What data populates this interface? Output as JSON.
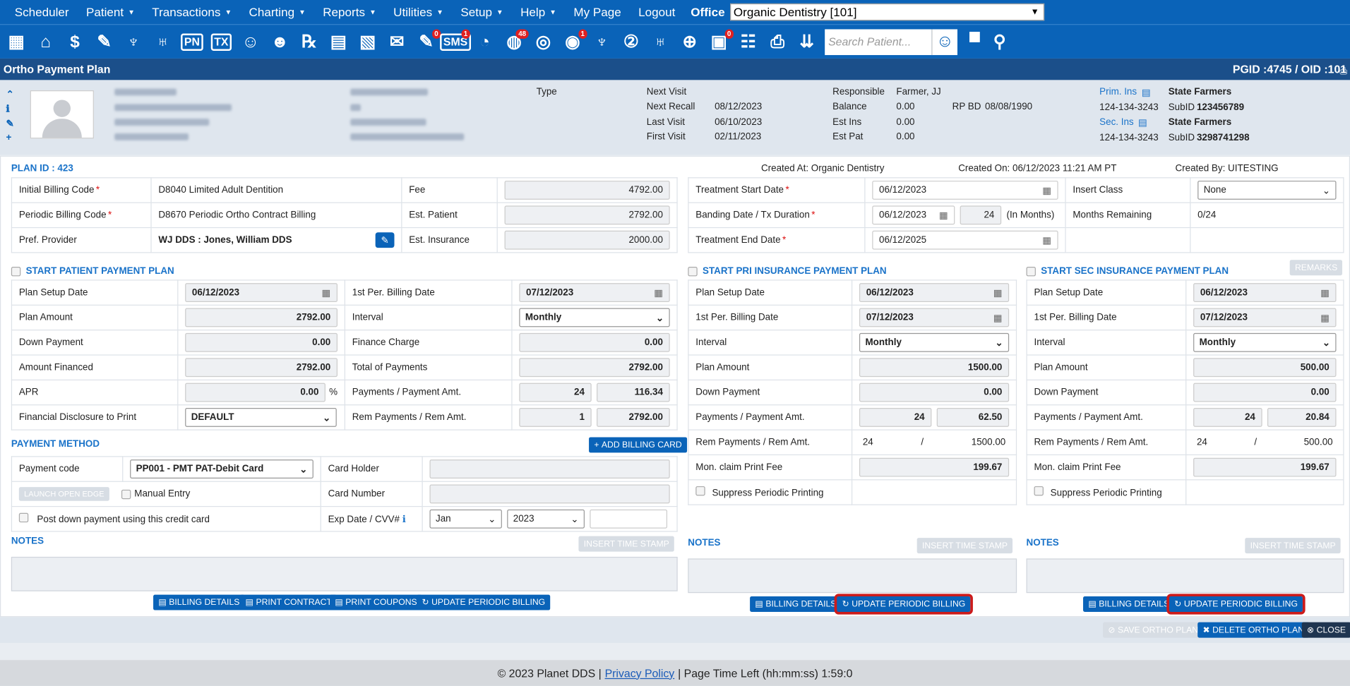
{
  "menu": {
    "items": [
      "Scheduler",
      "Patient",
      "Transactions",
      "Charting",
      "Reports",
      "Utilities",
      "Setup",
      "Help",
      "My Page",
      "Logout"
    ],
    "office_label": "Office",
    "office_value": "Organic Dentistry [101]"
  },
  "toolbar": {
    "badges": {
      "chat": "0",
      "sms": "1",
      "web": "48",
      "alert": "1",
      "eclaim": "0"
    },
    "sms_label": "SMS",
    "pn_label": "PN",
    "tx_label": "TX",
    "search_placeholder": "Search Patient..."
  },
  "titlebar": {
    "title": "Ortho Payment Plan",
    "ids": "PGID :4745  /  OID :101"
  },
  "patient": {
    "type_label": "Type",
    "next_visit_label": "Next Visit",
    "next_visit": "",
    "next_recall_label": "Next Recall",
    "next_recall": "08/12/2023",
    "last_visit_label": "Last Visit",
    "last_visit": "06/10/2023",
    "first_visit_label": "First Visit",
    "first_visit": "02/11/2023",
    "responsible_label": "Responsible",
    "responsible": "Farmer, JJ",
    "balance_label": "Balance",
    "balance": "0.00",
    "rp_bd_label": "RP BD",
    "rp_bd": "08/08/1990",
    "est_ins_label": "Est Ins",
    "est_ins": "0.00",
    "est_pat_label": "Est Pat",
    "est_pat": "0.00",
    "prim_ins_label": "Prim. Ins",
    "prim_ins": "State Farmers",
    "prim_phone": "124-134-3243",
    "prim_subid_label": "SubID",
    "prim_subid": "123456789",
    "sec_ins_label": "Sec. Ins",
    "sec_ins": "State Farmers",
    "sec_phone": "124-134-3243",
    "sec_subid_label": "SubID",
    "sec_subid": "3298741298"
  },
  "plan": {
    "plan_id": "PLAN ID : 423",
    "created_at": "Created At: Organic Dentistry",
    "created_on": "Created On: 06/12/2023 11:21 AM PT",
    "created_by": "Created By: UITESTING",
    "initial_billing_label": "Initial Billing Code",
    "initial_billing": "D8040 Limited Adult Dentition",
    "periodic_billing_label": "Periodic Billing Code",
    "periodic_billing": "D8670 Periodic Ortho Contract Billing",
    "pref_provider_label": "Pref. Provider",
    "pref_provider": "WJ DDS : Jones, William DDS",
    "fee_label": "Fee",
    "fee": "4792.00",
    "est_patient_label": "Est. Patient",
    "est_patient": "2792.00",
    "est_insurance_label": "Est. Insurance",
    "est_insurance": "2000.00",
    "tx_start_label": "Treatment Start Date",
    "tx_start": "06/12/2023",
    "banding_label": "Banding Date / Tx Duration",
    "banding": "06/12/2023",
    "duration": "24",
    "duration_unit": "(In Months)",
    "tx_end_label": "Treatment End Date",
    "tx_end": "06/12/2025",
    "insert_class_label": "Insert Class",
    "insert_class": "None",
    "months_remaining_label": "Months Remaining",
    "months_remaining": "0/24"
  },
  "patient_plan": {
    "header": "START PATIENT PAYMENT PLAN",
    "setup_label": "Plan Setup Date",
    "setup": "06/12/2023",
    "amount_label": "Plan Amount",
    "amount": "2792.00",
    "down_label": "Down Payment",
    "down": "0.00",
    "financed_label": "Amount Financed",
    "financed": "2792.00",
    "apr_label": "APR",
    "apr": "0.00",
    "apr_unit": "%",
    "disclosure_label": "Financial Disclosure to Print",
    "disclosure": "DEFAULT",
    "first_billing_label": "1st Per. Billing Date",
    "first_billing": "07/12/2023",
    "interval_label": "Interval",
    "interval": "Monthly",
    "finance_charge_label": "Finance Charge",
    "finance_charge": "0.00",
    "total_label": "Total of Payments",
    "total": "2792.00",
    "payments_label": "Payments / Payment Amt.",
    "payments": "24",
    "payment_amt": "116.34",
    "rem_label": "Rem Payments / Rem Amt.",
    "rem_payments": "1",
    "rem_amt": "2792.00"
  },
  "payment_method": {
    "header": "PAYMENT METHOD",
    "add_card": "ADD BILLING CARD",
    "code_label": "Payment code",
    "code": "PP001 - PMT PAT-Debit Card",
    "launch": "LAUNCH OPEN EDGE",
    "manual": "Manual Entry",
    "post_down": "Post down payment using this credit card",
    "holder_label": "Card Holder",
    "number_label": "Card Number",
    "exp_label": "Exp Date / CVV#",
    "exp_month": "Jan",
    "exp_year": "2023"
  },
  "pri_plan": {
    "header": "START PRI INSURANCE PAYMENT PLAN",
    "setup_label": "Plan Setup Date",
    "setup": "06/12/2023",
    "first_billing_label": "1st Per. Billing Date",
    "first_billing": "07/12/2023",
    "interval_label": "Interval",
    "interval": "Monthly",
    "amount_label": "Plan Amount",
    "amount": "1500.00",
    "down_label": "Down Payment",
    "down": "0.00",
    "payments_label": "Payments / Payment Amt.",
    "payments": "24",
    "payment_amt": "62.50",
    "rem_label": "Rem Payments / Rem Amt.",
    "rem_payments": "24",
    "rem_sep": "/",
    "rem_amt": "1500.00",
    "claim_label": "Mon. claim Print Fee",
    "claim": "199.67",
    "suppress": "Suppress Periodic Printing"
  },
  "sec_plan": {
    "header": "START SEC INSURANCE PAYMENT PLAN",
    "remarks": "REMARKS",
    "setup_label": "Plan Setup Date",
    "setup": "06/12/2023",
    "first_billing_label": "1st Per. Billing Date",
    "first_billing": "07/12/2023",
    "interval_label": "Interval",
    "interval": "Monthly",
    "amount_label": "Plan Amount",
    "amount": "500.00",
    "down_label": "Down Payment",
    "down": "0.00",
    "payments_label": "Payments / Payment Amt.",
    "payments": "24",
    "payment_amt": "20.84",
    "rem_label": "Rem Payments / Rem Amt.",
    "rem_payments": "24",
    "rem_sep": "/",
    "rem_amt": "500.00",
    "claim_label": "Mon. claim Print Fee",
    "claim": "199.67",
    "suppress": "Suppress Periodic Printing"
  },
  "notes": {
    "label": "NOTES",
    "stamp": "INSERT TIME STAMP"
  },
  "buttons": {
    "billing_details": "BILLING DETAILS",
    "print_contract": "PRINT CONTRACT",
    "print_coupons": "PRINT COUPONS",
    "update_periodic": "UPDATE PERIODIC BILLING",
    "save": "SAVE ORTHO PLAN",
    "delete": "DELETE ORTHO PLAN",
    "close": "CLOSE"
  },
  "footer": {
    "copyright": "© 2023 Planet DDS |",
    "privacy": "Privacy Policy",
    "time_left": "|  Page Time Left (hh:mm:ss) 1:59:0"
  }
}
